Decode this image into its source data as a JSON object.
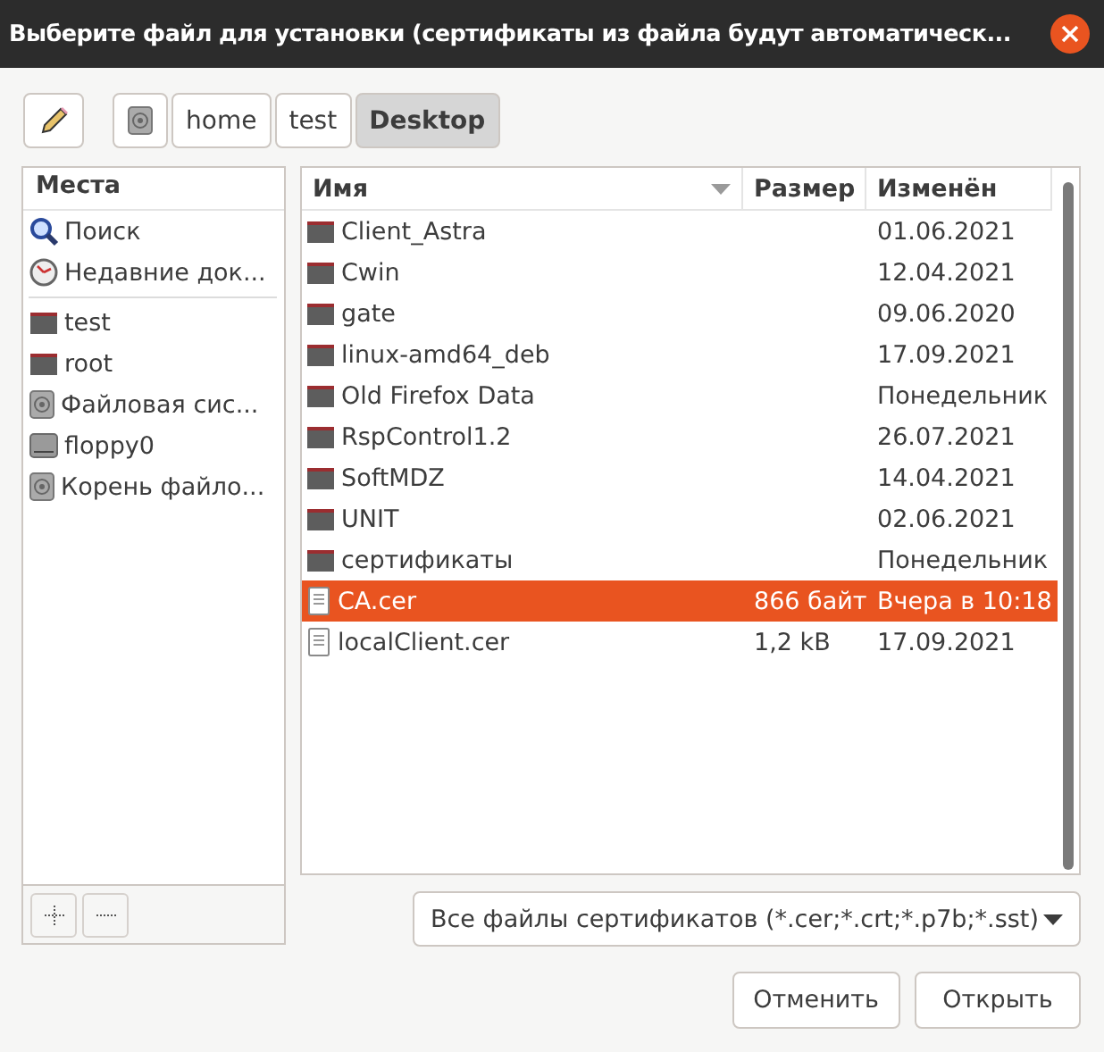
{
  "window": {
    "title": "Выберите файл для установки (сертификаты из файла будут автоматическ..."
  },
  "path_bar": [
    {
      "kind": "drive",
      "selected": false
    },
    {
      "kind": "text",
      "label": "home",
      "selected": false
    },
    {
      "kind": "text",
      "label": "test",
      "selected": false
    },
    {
      "kind": "text",
      "label": "Desktop",
      "selected": true
    }
  ],
  "sidebar": {
    "title": "Места",
    "groups": [
      [
        {
          "kind": "search",
          "label": "Поиск"
        },
        {
          "kind": "recent",
          "label": "Недавние док..."
        }
      ],
      [
        {
          "kind": "folder",
          "label": "test"
        },
        {
          "kind": "folder",
          "label": "root"
        },
        {
          "kind": "drive",
          "label": "Файловая сис..."
        },
        {
          "kind": "floppy",
          "label": "floppy0"
        },
        {
          "kind": "drive",
          "label": "Корень файло..."
        }
      ]
    ]
  },
  "table": {
    "columns": [
      "Имя",
      "Размер",
      "Изменён"
    ],
    "rows": [
      {
        "kind": "folder",
        "name": "Client_Astra",
        "size": "",
        "modified": "01.06.2021",
        "selected": false
      },
      {
        "kind": "folder",
        "name": "Cwin",
        "size": "",
        "modified": "12.04.2021",
        "selected": false
      },
      {
        "kind": "folder",
        "name": "gate",
        "size": "",
        "modified": "09.06.2020",
        "selected": false
      },
      {
        "kind": "folder",
        "name": "linux-amd64_deb",
        "size": "",
        "modified": "17.09.2021",
        "selected": false
      },
      {
        "kind": "folder",
        "name": "Old Firefox Data",
        "size": "",
        "modified": "Понедельник",
        "selected": false
      },
      {
        "kind": "folder",
        "name": "RspControl1.2",
        "size": "",
        "modified": "26.07.2021",
        "selected": false
      },
      {
        "kind": "folder",
        "name": "SoftMDZ",
        "size": "",
        "modified": "14.04.2021",
        "selected": false
      },
      {
        "kind": "folder",
        "name": "UNIT",
        "size": "",
        "modified": "02.06.2021",
        "selected": false
      },
      {
        "kind": "folder",
        "name": "сертификаты",
        "size": "",
        "modified": "Понедельник",
        "selected": false
      },
      {
        "kind": "file",
        "name": "CA.cer",
        "size": "866 байт",
        "modified": "Вчера в 10:18",
        "selected": true
      },
      {
        "kind": "file",
        "name": "localClient.cer",
        "size": "1,2 kB",
        "modified": "17.09.2021",
        "selected": false
      }
    ]
  },
  "filter": {
    "value": "Все файлы сертификатов (*.cer;*.crt;*.p7b;*.sst)"
  },
  "buttons": [
    "Отменить",
    "Открыть"
  ]
}
